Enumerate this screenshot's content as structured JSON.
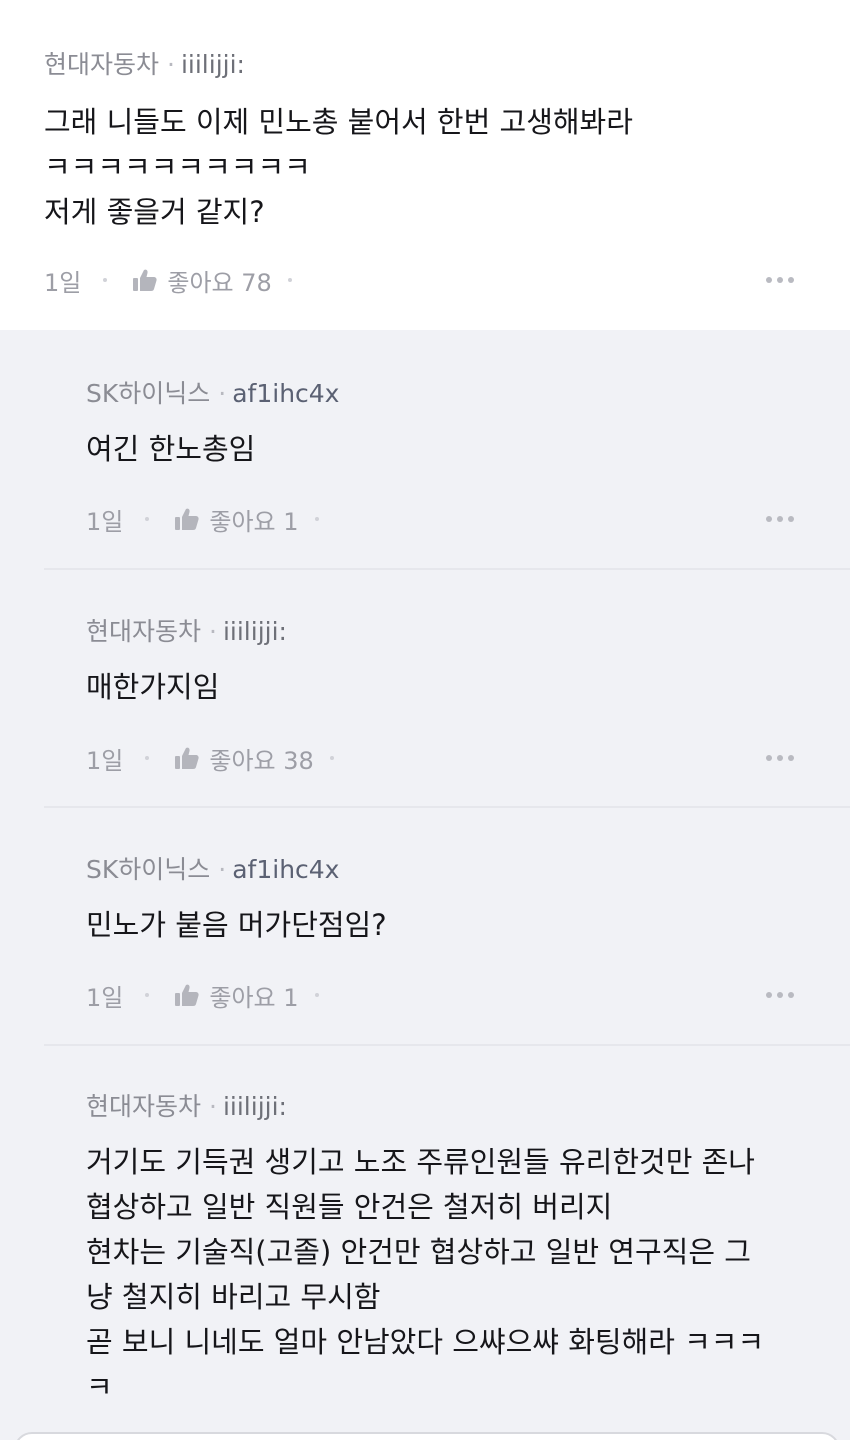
{
  "parent": {
    "company": "현대자동차",
    "nickname": "iiilijji:",
    "text": "그래 니들도 이제 민노총 붙어서 한번 고생해봐라\nㅋㅋㅋㅋㅋㅋㅋㅋㅋㅋ\n저게 좋을거 같지?",
    "time": "1일",
    "like_label": "좋아요 78",
    "like_icon": "thumbs-up-icon",
    "more_icon": "more-dots-icon"
  },
  "replies": [
    {
      "company": "SK하이닉스",
      "nickname": "af1ihc4x",
      "text": "여긴 한노총임",
      "time": "1일",
      "like_label": "좋아요 1"
    },
    {
      "company": "현대자동차",
      "nickname": "iiilijji:",
      "text": "매한가지임",
      "time": "1일",
      "like_label": "좋아요 38"
    },
    {
      "company": "SK하이닉스",
      "nickname": "af1ihc4x",
      "text": "민노가 붙음 머가단점임?",
      "time": "1일",
      "like_label": "좋아요 1"
    },
    {
      "company": "현대자동차",
      "nickname": "iiilijji:",
      "text": "거기도 기득권 생기고 노조 주류인원들 유리한것만 존나\n협상하고 일반 직원들 안건은 철저히 버리지\n현차는 기술직(고졸) 안건만 협상하고 일반 연구직은 그\n냥 철지히 바리고 무시함\n곧 보니 니네도 얼마 안남았다 으쌰으쌰 화팅해라 ㅋㅋㅋ\nㅋ",
      "time": "",
      "like_label": ""
    }
  ],
  "colors": {
    "reply_background": "#f1f2f6",
    "meta_text": "#8b8c94",
    "body_text": "#16161a"
  }
}
